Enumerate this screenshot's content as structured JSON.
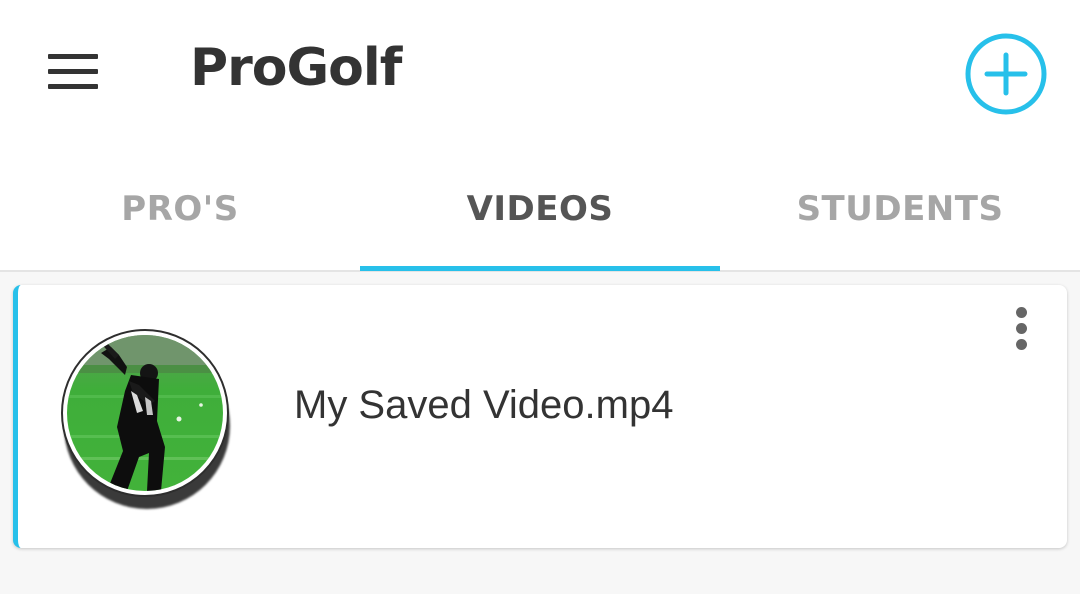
{
  "app": {
    "title": "ProGolf",
    "accent_color": "#27c0ea",
    "menu_icon": "hamburger-menu-icon",
    "add_icon": "add-circle-icon"
  },
  "tabs": [
    {
      "label": "PRO'S",
      "active": false
    },
    {
      "label": "VIDEOS",
      "active": true
    },
    {
      "label": "STUDENTS",
      "active": false
    }
  ],
  "videos": [
    {
      "name": "My Saved Video.mp4",
      "thumbnail": "golfer-swing-thumbnail",
      "menu_icon": "more-vert-icon"
    }
  ]
}
